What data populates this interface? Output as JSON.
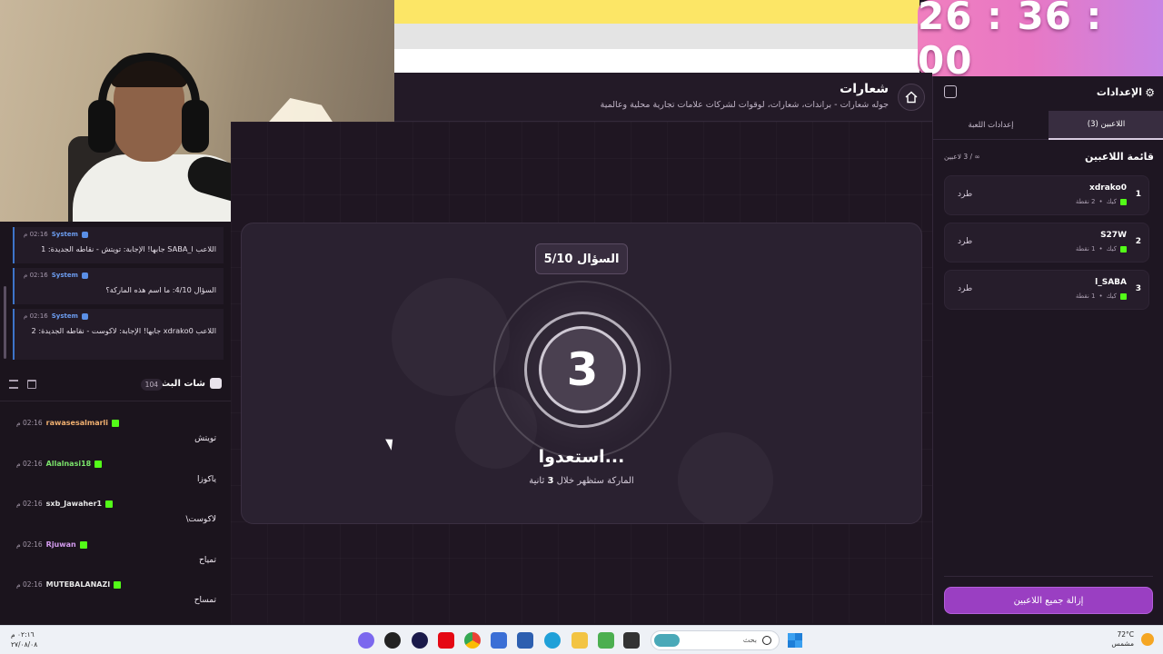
{
  "timer": "26 : 36 : 00",
  "header": {
    "title": "شعارات",
    "subtitle": "جوله شعارات - براندات، شعارات، لوقوات لشركات علامات تجارية محلية وعالمية"
  },
  "game": {
    "question_badge": "السؤال 5/10",
    "countdown": "3",
    "ready_text": "استعدوا...",
    "sub_prefix": "الماركة ستظهر خلال",
    "sub_number": "3",
    "sub_suffix": "ثانية"
  },
  "system_messages": [
    {
      "sender": "System",
      "time": "02:16 م",
      "text": "اللاعب SABA_l جابها! الإجابة: تويتش - نقاطه الجديدة: 1"
    },
    {
      "sender": "System",
      "time": "02:16 م",
      "text": "السؤال 4/10: ما اسم هذه الماركة؟"
    },
    {
      "sender": "System",
      "time": "02:16 م",
      "text": "اللاعب xdrako0 جابها! الإجابة: لاكوست - نقاطه الجديدة: 2"
    }
  ],
  "chat": {
    "title": "شات البث",
    "count": "104",
    "messages": [
      {
        "user": "rawasesalmarli",
        "color": "#f0b070",
        "time": "02:16 م",
        "text": "تويتش"
      },
      {
        "user": "Allalnasi18",
        "color": "#7be36b",
        "time": "02:16 م",
        "text": "ياكوزا"
      },
      {
        "user": "sxb_Jawaher1",
        "color": "#e6e6e6",
        "time": "02:16 م",
        "text": "لاكوست\\"
      },
      {
        "user": "Rjuwan",
        "color": "#d59cf0",
        "time": "02:16 م",
        "text": "تمياح"
      },
      {
        "user": "MUTEBALANAZI",
        "color": "#e6e6e6",
        "time": "02:16 م",
        "text": "تمساح"
      }
    ]
  },
  "sidebar": {
    "title": "الإعدادات",
    "tab_players": "اللاعبين (3)",
    "tab_game": "إعدادات اللعبة",
    "players_title": "قائمة اللاعبين",
    "players_count": "∞ / 3 لاعبين",
    "players": [
      {
        "rank": "1",
        "name": "xdrako0",
        "platform": "كيك",
        "points": "2 نقطة",
        "kick": "طرد"
      },
      {
        "rank": "2",
        "name": "S27W",
        "platform": "كيك",
        "points": "1 نقطة",
        "kick": "طرد"
      },
      {
        "rank": "3",
        "name": "l_SABA",
        "platform": "كيك",
        "points": "1 نقطة",
        "kick": "طرد"
      }
    ],
    "remove_all": "إزالة جميع اللاعبين"
  },
  "taskbar": {
    "search": "بحث",
    "weather_temp": "72°C",
    "weather_desc": "مشمس",
    "clock_time": "٠٢:١٦ م",
    "clock_date": "٢٧/٠٨/٠٨"
  }
}
